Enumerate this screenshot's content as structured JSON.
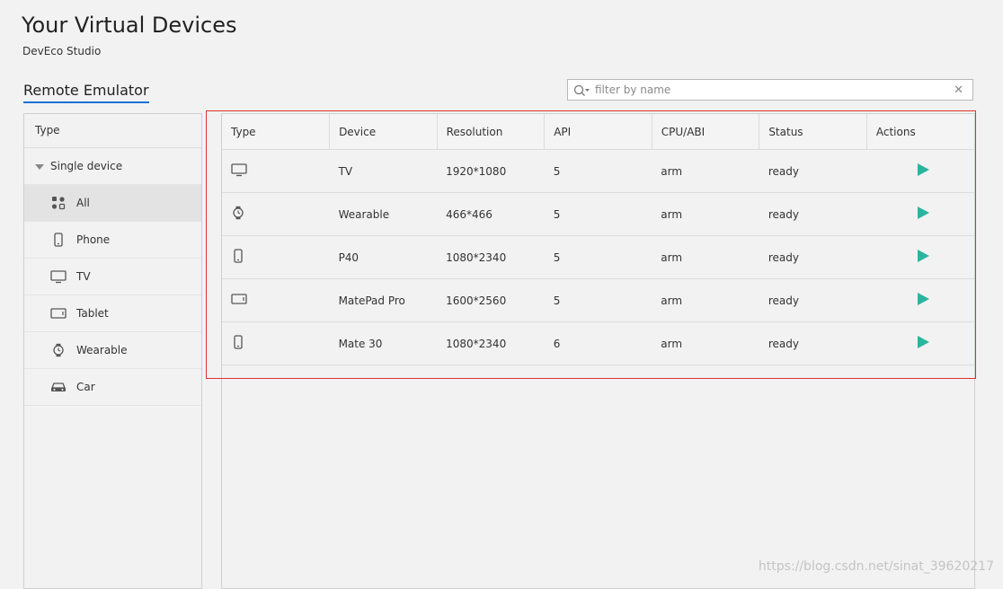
{
  "header": {
    "title": "Your Virtual Devices",
    "subtitle": "DevEco Studio"
  },
  "tabs": [
    {
      "label": "Remote Emulator",
      "active": true
    }
  ],
  "search": {
    "placeholder": "filter by name",
    "value": ""
  },
  "sidebar": {
    "header": "Type",
    "group": "Single device",
    "items": [
      {
        "label": "All",
        "icon": "grid-icon",
        "active": true
      },
      {
        "label": "Phone",
        "icon": "phone-icon"
      },
      {
        "label": "TV",
        "icon": "tv-icon"
      },
      {
        "label": "Tablet",
        "icon": "tablet-icon"
      },
      {
        "label": "Wearable",
        "icon": "watch-icon"
      },
      {
        "label": "Car",
        "icon": "car-icon"
      }
    ]
  },
  "table": {
    "columns": [
      "Type",
      "Device",
      "Resolution",
      "API",
      "CPU/ABI",
      "Status",
      "Actions"
    ],
    "rows": [
      {
        "icon": "tv-icon",
        "device": "TV",
        "resolution": "1920*1080",
        "api": "5",
        "cpu": "arm",
        "status": "ready"
      },
      {
        "icon": "watch-icon",
        "device": "Wearable",
        "resolution": "466*466",
        "api": "5",
        "cpu": "arm",
        "status": "ready"
      },
      {
        "icon": "phone-icon",
        "device": "P40",
        "resolution": "1080*2340",
        "api": "5",
        "cpu": "arm",
        "status": "ready"
      },
      {
        "icon": "tablet-icon",
        "device": "MatePad Pro",
        "resolution": "1600*2560",
        "api": "5",
        "cpu": "arm",
        "status": "ready"
      },
      {
        "icon": "phone-icon",
        "device": "Mate 30",
        "resolution": "1080*2340",
        "api": "6",
        "cpu": "arm",
        "status": "ready"
      }
    ]
  },
  "watermark": "https://blog.csdn.net/sinat_39620217",
  "colors": {
    "accent": "#1e70d6",
    "play": "#2bb59f",
    "highlight_border": "#e03131"
  }
}
